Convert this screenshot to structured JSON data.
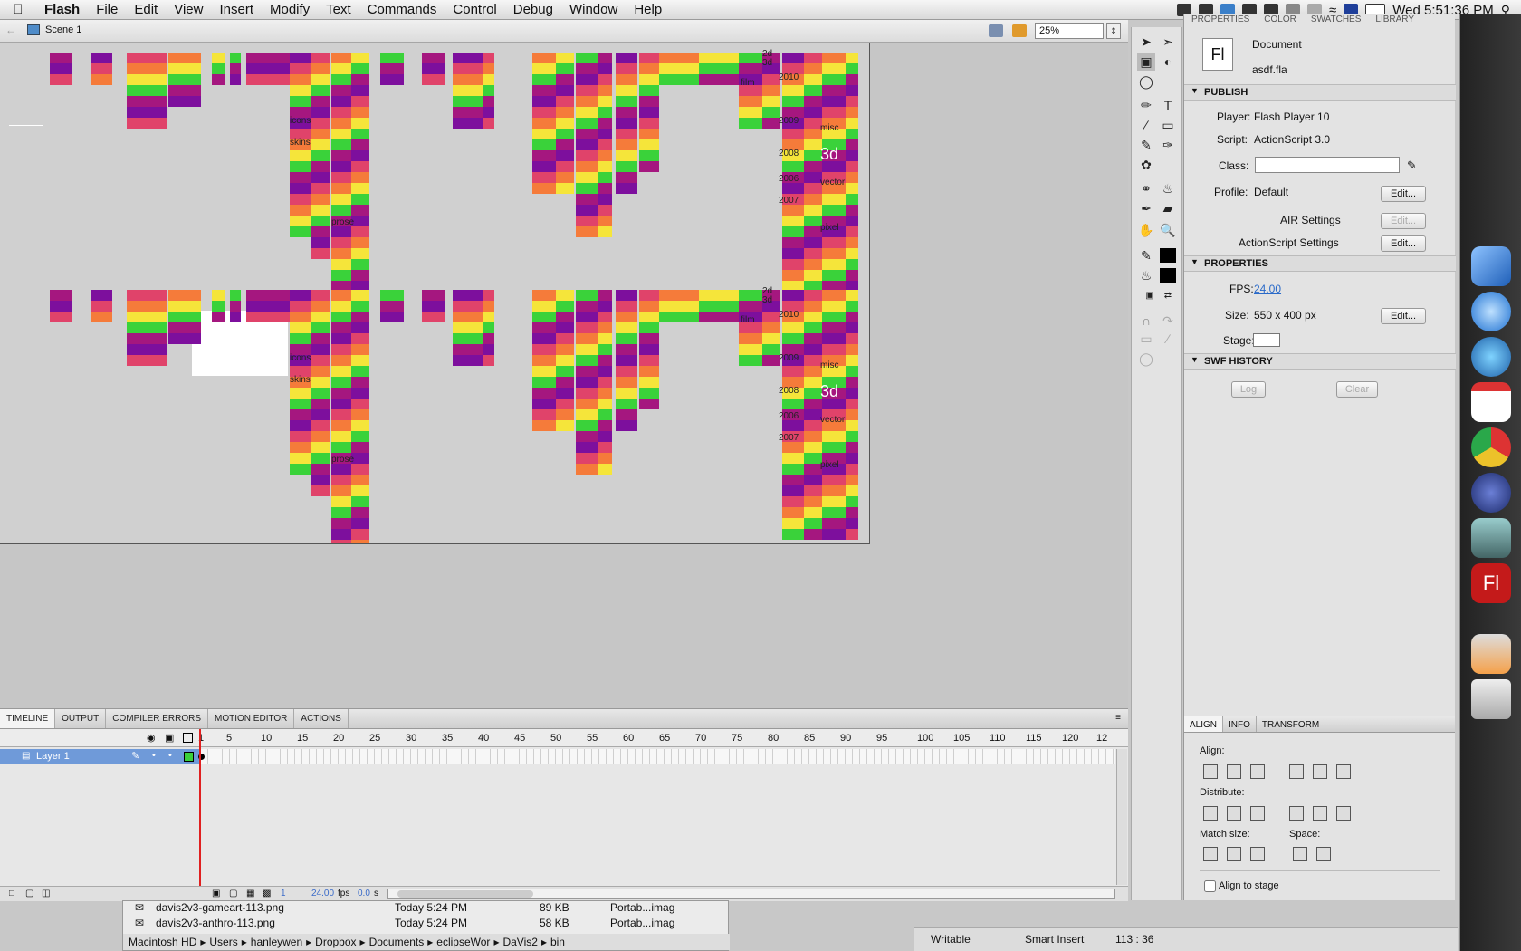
{
  "menubar": {
    "app": "Flash",
    "items": [
      "File",
      "Edit",
      "View",
      "Insert",
      "Modify",
      "Text",
      "Commands",
      "Control",
      "Debug",
      "Window",
      "Help"
    ],
    "clock": "Wed 5:51:36 PM"
  },
  "editbar": {
    "scene": "Scene 1",
    "zoom": "25%"
  },
  "stage": {
    "labels": [
      "2d",
      "3d",
      "film",
      "2010",
      "2009",
      "2008",
      "2006",
      "2007",
      "misc",
      "3d",
      "skins",
      "icons",
      "prose",
      "vector",
      "pixel"
    ]
  },
  "timeline": {
    "tabs": [
      "TIMELINE",
      "OUTPUT",
      "COMPILER ERRORS",
      "MOTION EDITOR",
      "ACTIONS"
    ],
    "ruler": [
      "1",
      "5",
      "10",
      "15",
      "20",
      "25",
      "30",
      "35",
      "40",
      "45",
      "50",
      "55",
      "60",
      "65",
      "70",
      "75",
      "80",
      "85",
      "90",
      "95",
      "100",
      "105",
      "110",
      "115",
      "120",
      "12"
    ],
    "layer": "Layer 1",
    "frame": "1",
    "fps": "24.00",
    "fps_unit": "fps",
    "time": "0.0",
    "time_unit": "s"
  },
  "properties": {
    "tabs": [
      "PROPERTIES",
      "COLOR",
      "SWATCHES",
      "LIBRARY"
    ],
    "doc_label": "Document",
    "doc_name": "asdf.fla",
    "doc_icon": "Fl",
    "publish": "PUBLISH",
    "player_label": "Player:",
    "player": "Flash Player 10",
    "script_label": "Script:",
    "script": "ActionScript 3.0",
    "class_label": "Class:",
    "profile_label": "Profile:",
    "profile": "Default",
    "edit": "Edit...",
    "air": "AIR Settings",
    "as_settings": "ActionScript Settings",
    "props": "PROPERTIES",
    "fps_label": "FPS:",
    "fps": "24.00",
    "size_label": "Size:",
    "size": "550 x 400 px",
    "stage_label": "Stage:",
    "swf": "SWF HISTORY",
    "log": "Log",
    "clear": "Clear"
  },
  "align": {
    "tabs": [
      "ALIGN",
      "INFO",
      "TRANSFORM"
    ],
    "align_label": "Align:",
    "distribute_label": "Distribute:",
    "match_label": "Match size:",
    "space_label": "Space:",
    "to_stage": "Align to stage"
  },
  "finder": {
    "rows": [
      {
        "name": "davis2v3-gameart-113.png",
        "date": "Today 5:24 PM",
        "size": "89 KB",
        "kind": "Portab...imag"
      },
      {
        "name": "davis2v3-anthro-113.png",
        "date": "Today 5:24 PM",
        "size": "58 KB",
        "kind": "Portab...imag"
      }
    ],
    "path": [
      "Macintosh HD",
      "Users",
      "hanleywen",
      "Dropbox",
      "Documents",
      "eclipseWor",
      "DaVis2",
      "bin"
    ]
  },
  "statusbar": {
    "writable": "Writable",
    "insert": "Smart Insert",
    "position": "113 : 36"
  },
  "colors": {
    "magenta": "#a5177f",
    "purple": "#7d0f9d",
    "pink": "#e0436a",
    "orange": "#f57b3a",
    "yellow": "#f5e53a",
    "green": "#3ad23a",
    "layer_blue": "#6f9ad9"
  }
}
